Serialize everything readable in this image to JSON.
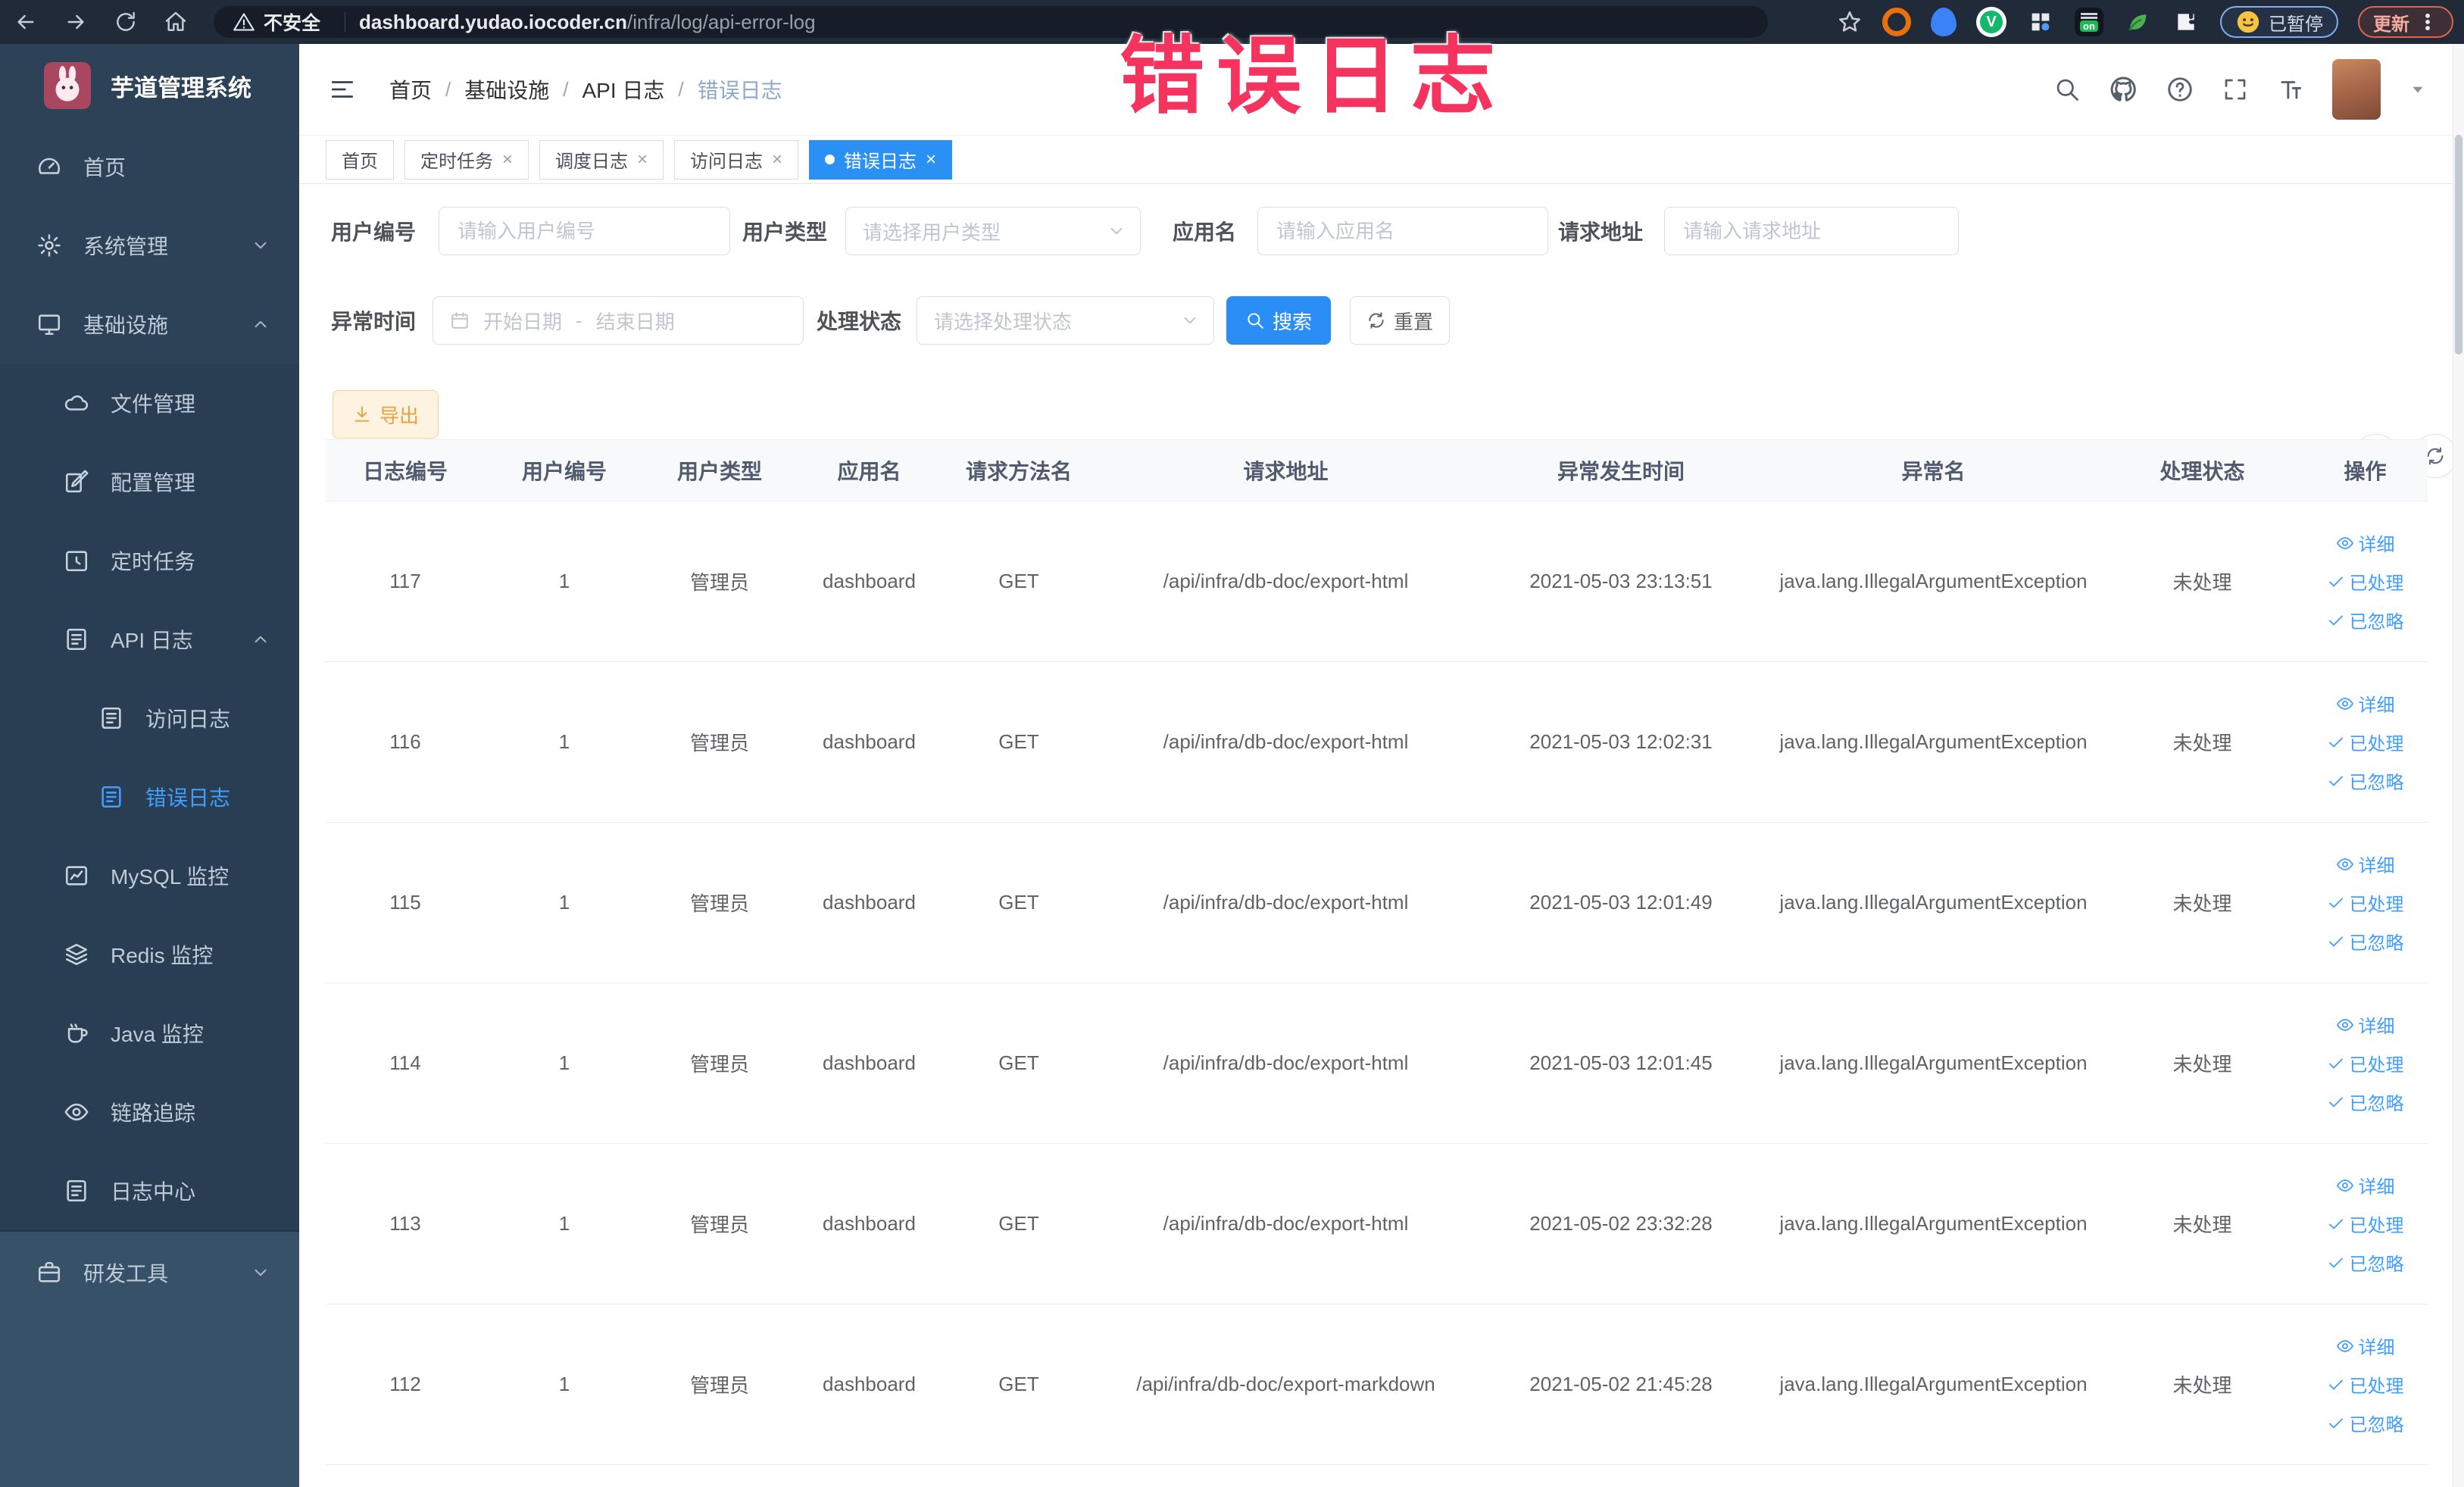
{
  "browser": {
    "security_label": "不安全",
    "url_host": "dashboard.yudao.iocoder.cn",
    "url_path": "/infra/log/api-error-log",
    "on_badge": "on",
    "profile_badge": "已暂停",
    "update_label": "更新"
  },
  "annotation": {
    "text": "错误日志",
    "color": "#f4345f"
  },
  "sidebar": {
    "title": "芋道管理系统",
    "items": [
      {
        "label": "首页"
      },
      {
        "label": "系统管理"
      },
      {
        "label": "基础设施"
      },
      {
        "label": "文件管理"
      },
      {
        "label": "配置管理"
      },
      {
        "label": "定时任务"
      },
      {
        "label": "API 日志"
      },
      {
        "label": "访问日志"
      },
      {
        "label": "错误日志"
      },
      {
        "label": "MySQL 监控"
      },
      {
        "label": "Redis 监控"
      },
      {
        "label": "Java 监控"
      },
      {
        "label": "链路追踪"
      },
      {
        "label": "日志中心"
      },
      {
        "label": "研发工具"
      }
    ]
  },
  "header": {
    "breadcrumb": [
      "首页",
      "基础设施",
      "API 日志",
      "错误日志"
    ]
  },
  "tabs": [
    {
      "label": "首页"
    },
    {
      "label": "定时任务"
    },
    {
      "label": "调度日志"
    },
    {
      "label": "访问日志"
    },
    {
      "label": "错误日志"
    }
  ],
  "filters": {
    "user_id": {
      "label": "用户编号",
      "placeholder": "请输入用户编号"
    },
    "user_type": {
      "label": "用户类型",
      "placeholder": "请选择用户类型"
    },
    "app_name": {
      "label": "应用名",
      "placeholder": "请输入应用名"
    },
    "request_url": {
      "label": "请求地址",
      "placeholder": "请输入请求地址"
    },
    "exception_time": {
      "label": "异常时间",
      "start_placeholder": "开始日期",
      "separator": "-",
      "end_placeholder": "结束日期"
    },
    "process_status": {
      "label": "处理状态",
      "placeholder": "请选择处理状态"
    },
    "search_label": "搜索",
    "reset_label": "重置"
  },
  "toolbar": {
    "export_label": "导出"
  },
  "table": {
    "columns": [
      "日志编号",
      "用户编号",
      "用户类型",
      "应用名",
      "请求方法名",
      "请求地址",
      "异常发生时间",
      "异常名",
      "处理状态",
      "操作"
    ],
    "actions": {
      "detail": "详细",
      "processed": "已处理",
      "ignored": "已忽略"
    },
    "rows": [
      {
        "log_id": "117",
        "user_id": "1",
        "user_type": "管理员",
        "app_name": "dashboard",
        "method": "GET",
        "url": "/api/infra/db-doc/export-html",
        "time": "2021-05-03 23:13:51",
        "exception": "java.lang.IllegalArgumentException",
        "status": "未处理"
      },
      {
        "log_id": "116",
        "user_id": "1",
        "user_type": "管理员",
        "app_name": "dashboard",
        "method": "GET",
        "url": "/api/infra/db-doc/export-html",
        "time": "2021-05-03 12:02:31",
        "exception": "java.lang.IllegalArgumentException",
        "status": "未处理"
      },
      {
        "log_id": "115",
        "user_id": "1",
        "user_type": "管理员",
        "app_name": "dashboard",
        "method": "GET",
        "url": "/api/infra/db-doc/export-html",
        "time": "2021-05-03 12:01:49",
        "exception": "java.lang.IllegalArgumentException",
        "status": "未处理"
      },
      {
        "log_id": "114",
        "user_id": "1",
        "user_type": "管理员",
        "app_name": "dashboard",
        "method": "GET",
        "url": "/api/infra/db-doc/export-html",
        "time": "2021-05-03 12:01:45",
        "exception": "java.lang.IllegalArgumentException",
        "status": "未处理"
      },
      {
        "log_id": "113",
        "user_id": "1",
        "user_type": "管理员",
        "app_name": "dashboard",
        "method": "GET",
        "url": "/api/infra/db-doc/export-html",
        "time": "2021-05-02 23:32:28",
        "exception": "java.lang.IllegalArgumentException",
        "status": "未处理"
      },
      {
        "log_id": "112",
        "user_id": "1",
        "user_type": "管理员",
        "app_name": "dashboard",
        "method": "GET",
        "url": "/api/infra/db-doc/export-markdown",
        "time": "2021-05-02 21:45:28",
        "exception": "java.lang.IllegalArgumentException",
        "status": "未处理"
      }
    ]
  }
}
